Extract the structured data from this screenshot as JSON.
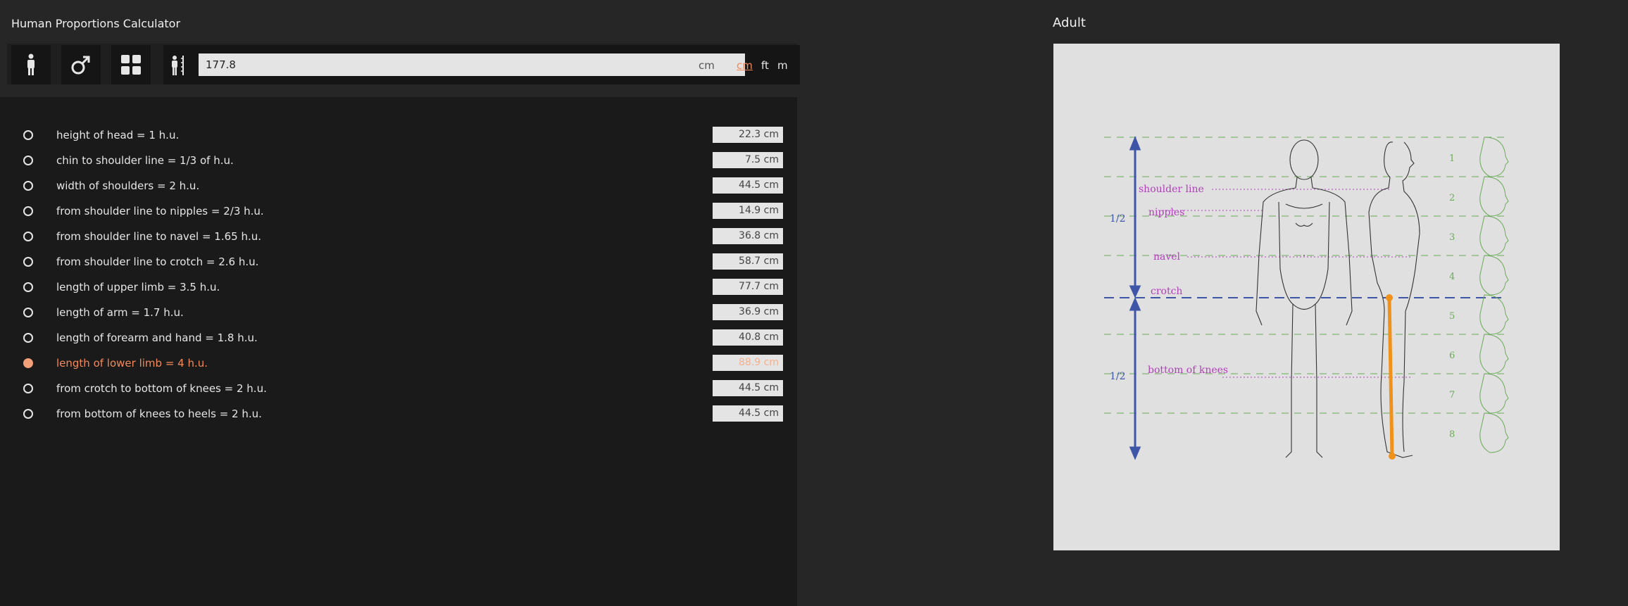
{
  "app": {
    "title": "Human Proportions Calculator"
  },
  "toolbar": {
    "height_value": "177.8",
    "height_unit_suffix": "cm",
    "units": [
      {
        "label": "cm",
        "active": true
      },
      {
        "label": "ft",
        "active": false
      },
      {
        "label": "m",
        "active": false
      }
    ]
  },
  "measurements": [
    {
      "label": "height of head = 1 h.u.",
      "value": "22.3 cm",
      "selected": false
    },
    {
      "label": "chin to shoulder line = 1/3 of h.u.",
      "value": "7.5 cm",
      "selected": false
    },
    {
      "label": "width of shoulders = 2 h.u.",
      "value": "44.5 cm",
      "selected": false
    },
    {
      "label": "from shoulder line to nipples = 2/3 h.u.",
      "value": "14.9 cm",
      "selected": false
    },
    {
      "label": "from shoulder line to navel = 1.65 h.u.",
      "value": "36.8 cm",
      "selected": false
    },
    {
      "label": "from shoulder line to crotch = 2.6 h.u.",
      "value": "58.7 cm",
      "selected": false
    },
    {
      "label": "length of upper limb = 3.5 h.u.",
      "value": "77.7 cm",
      "selected": false
    },
    {
      "label": "length of arm = 1.7 h.u.",
      "value": "36.9 cm",
      "selected": false
    },
    {
      "label": "length of forearm and hand = 1.8 h.u.",
      "value": "40.8 cm",
      "selected": false
    },
    {
      "label": "length of lower limb = 4 h.u.",
      "value": "88.9 cm",
      "selected": true
    },
    {
      "label": "from crotch to bottom of knees = 2 h.u.",
      "value": "44.5 cm",
      "selected": false
    },
    {
      "label": "from bottom of knees to heels = 2 h.u.",
      "value": "44.5 cm",
      "selected": false
    }
  ],
  "figure": {
    "title": "Adult",
    "landmarks": [
      "shoulder line",
      "nipples",
      "navel",
      "crotch",
      "bottom of knees"
    ],
    "half_label": "1/2",
    "head_numbers": [
      "1",
      "2",
      "3",
      "4",
      "5",
      "6",
      "7",
      "8"
    ],
    "colors": {
      "guide_green": "#6aaa5a",
      "magenta": "#b040b8",
      "blue": "#3f56a8",
      "orange": "#f0921a"
    }
  }
}
